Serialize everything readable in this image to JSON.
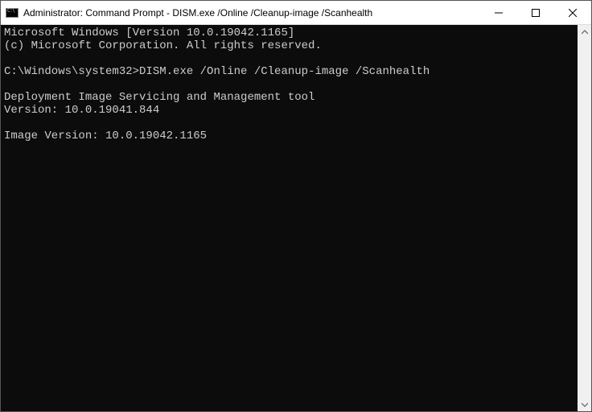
{
  "window": {
    "title": "Administrator: Command Prompt - DISM.exe  /Online /Cleanup-image /Scanhealth"
  },
  "terminal": {
    "line1": "Microsoft Windows [Version 10.0.19042.1165]",
    "line2": "(c) Microsoft Corporation. All rights reserved.",
    "blank1": "",
    "prompt": "C:\\Windows\\system32>",
    "command": "DISM.exe /Online /Cleanup-image /Scanhealth",
    "blank2": "",
    "output1": "Deployment Image Servicing and Management tool",
    "output2": "Version: 10.0.19041.844",
    "blank3": "",
    "output3": "Image Version: 10.0.19042.1165"
  }
}
